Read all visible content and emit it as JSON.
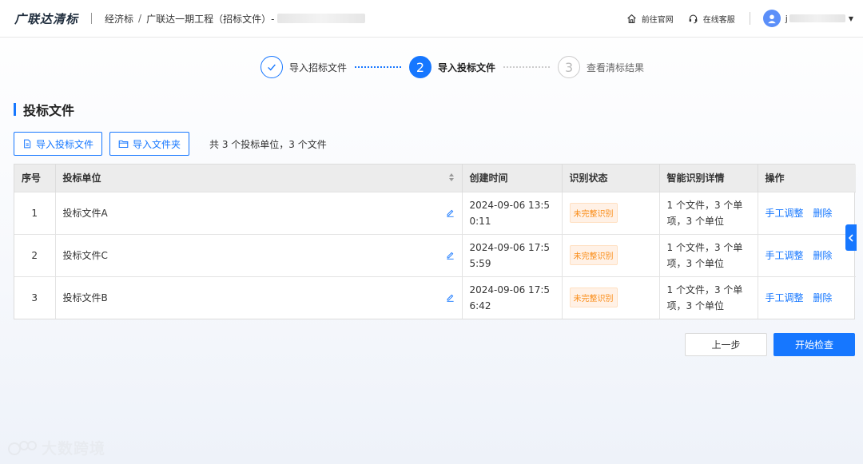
{
  "header": {
    "logo": "广联达清标",
    "breadcrumb": [
      "经济标",
      "广联达一期工程（招标文件）-"
    ],
    "links": [
      {
        "icon": "home-icon",
        "label": "前往官网"
      },
      {
        "icon": "headset-icon",
        "label": "在线客服"
      }
    ],
    "user_initial": "j"
  },
  "steps": [
    {
      "number": "1",
      "label": "导入招标文件",
      "status": "done"
    },
    {
      "number": "2",
      "label": "导入投标文件",
      "status": "active"
    },
    {
      "number": "3",
      "label": "查看清标结果",
      "status": "wait"
    }
  ],
  "section": {
    "title": "投标文件"
  },
  "toolbar": {
    "import_file_label": "导入投标文件",
    "import_folder_label": "导入文件夹",
    "count_text": "共 3 个投标单位，3 个文件"
  },
  "table": {
    "columns": [
      "序号",
      "投标单位",
      "创建时间",
      "识别状态",
      "智能识别详情",
      "操作"
    ],
    "rows": [
      {
        "index": "1",
        "name": "投标文件A",
        "created": "2024-09-06 13:50:11",
        "status": "未完整识别",
        "detail": "1 个文件，3 个单项，3 个单位",
        "actions": [
          "手工调整",
          "删除"
        ]
      },
      {
        "index": "2",
        "name": "投标文件C",
        "created": "2024-09-06 17:55:59",
        "status": "未完整识别",
        "detail": "1 个文件，3 个单项，3 个单位",
        "actions": [
          "手工调整",
          "删除"
        ]
      },
      {
        "index": "3",
        "name": "投标文件B",
        "created": "2024-09-06 17:56:42",
        "status": "未完整识别",
        "detail": "1 个文件，3 个单项，3 个单位",
        "actions": [
          "手工调整",
          "删除"
        ]
      }
    ]
  },
  "footer": {
    "prev_label": "上一步",
    "start_label": "开始检查"
  },
  "watermark": "大数跨境",
  "colors": {
    "accent": "#1677ff",
    "warning": "#fa8c16",
    "warning_bg": "#fff1e6"
  }
}
